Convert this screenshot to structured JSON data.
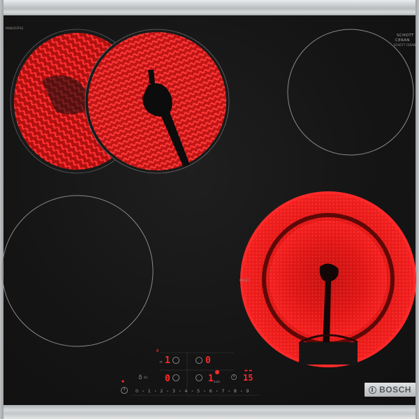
{
  "hob": {
    "brand": "BOSCH",
    "model_code": "PKN645FP1E",
    "glass_maker": "SCHOTT",
    "glass_brand": "CERAN",
    "glass_code": "SCHOTT CERAN",
    "label_left_mid": "ROAST",
    "accent_color": "#ff2a2a",
    "glass_color": "#151515",
    "frame_color": "#c6c9cb"
  },
  "controls": {
    "display_front_left": "1",
    "display_front_left_small": "0",
    "display_rear_left": "0",
    "display_back_right": "0",
    "display_front_right": "1",
    "timer_display": "15",
    "label_on": "On",
    "label_auto": "auto",
    "power_icon": "power-icon",
    "timer_icon": "clock-icon",
    "scale": [
      "0",
      "1",
      "2",
      "3",
      "4",
      "5",
      "6",
      "7",
      "8",
      "9"
    ]
  }
}
